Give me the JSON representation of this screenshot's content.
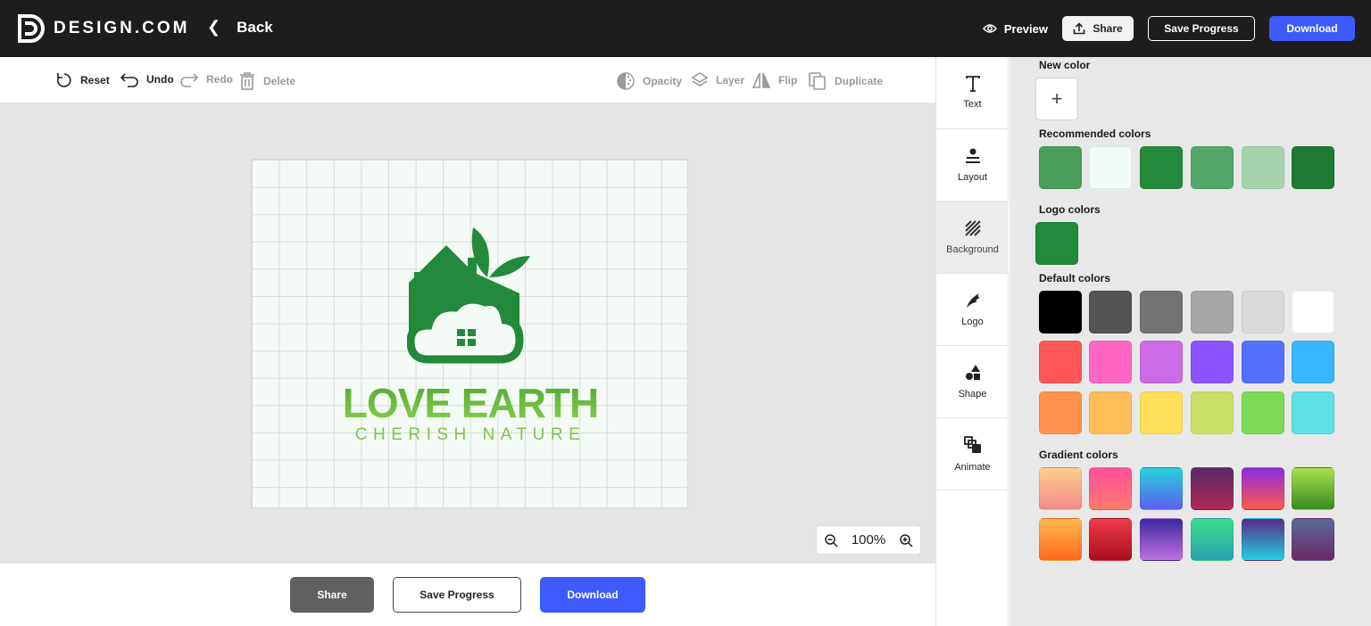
{
  "header": {
    "brand": "DESIGN.COM",
    "back_label": "Back",
    "preview_label": "Preview",
    "share_label": "Share",
    "save_label": "Save Progress",
    "download_label": "Download"
  },
  "toolbar": {
    "reset": "Reset",
    "undo": "Undo",
    "redo": "Redo",
    "delete": "Delete",
    "opacity": "Opacity",
    "layer": "Layer",
    "flip": "Flip",
    "duplicate": "Duplicate"
  },
  "canvas": {
    "logo_title": "LOVE EARTH",
    "logo_subtitle": "CHERISH NATURE",
    "zoom": "100%"
  },
  "bottom": {
    "share": "Share",
    "save": "Save Progress",
    "download": "Download"
  },
  "sidenav": [
    {
      "label": "Text",
      "icon": "text-icon"
    },
    {
      "label": "Layout",
      "icon": "layout-icon"
    },
    {
      "label": "Background",
      "icon": "background-icon",
      "active": true
    },
    {
      "label": "Logo",
      "icon": "logo-icon"
    },
    {
      "label": "Shape",
      "icon": "shape-icon"
    },
    {
      "label": "Animate",
      "icon": "animate-icon"
    }
  ],
  "panel": {
    "new_color_title": "New color",
    "recommended_title": "Recommended colors",
    "logo_colors_title": "Logo colors",
    "default_title": "Default colors",
    "gradient_title": "Gradient colors",
    "recommended": [
      "#4a9e5c",
      "#f1fbfa",
      "#228a3a",
      "#52a86a",
      "#a7d3b0",
      "#1e7a34"
    ],
    "logo_colors": [
      "#228a3a"
    ],
    "default_colors": [
      [
        "#000000",
        "#545454",
        "#737373",
        "#a6a6a6",
        "#d9d9d9",
        "#ffffff"
      ],
      [
        "#ff5757",
        "#ff66c4",
        "#cb6ce6",
        "#8c52ff",
        "#5271ff",
        "#38b6ff"
      ],
      [
        "#ff914d",
        "#ffbd59",
        "#ffde59",
        "#c9e265",
        "#7ed957",
        "#5ce1e6"
      ]
    ],
    "gradient_colors": [
      [
        "linear-gradient(#ffd08a,#f08a8a)",
        "linear-gradient(#ff4fa0,#ff7a6a)",
        "linear-gradient(#25d3d9,#5c5ff0)",
        "linear-gradient(#5a2a6a,#b02a55)",
        "linear-gradient(#8a2be2,#ff5a4a)",
        "linear-gradient(#a8e050,#3a8a20)"
      ],
      [
        "linear-gradient(#ffb84a,#ff6a20)",
        "linear-gradient(#ee3a4a,#a81020)",
        "linear-gradient(#3a2aa0,#c070e0)",
        "linear-gradient(#3ae08a,#2aa0b0)",
        "linear-gradient(#5a2a8a,#20d0e0)",
        "linear-gradient(#5a6a9a,#6a2a6a)"
      ]
    ]
  },
  "colors": {
    "topbar": "#1d1d1d",
    "accent": "#3d5afe",
    "logo_green": "#228a3a",
    "logo_light_green": "#7cc547"
  }
}
